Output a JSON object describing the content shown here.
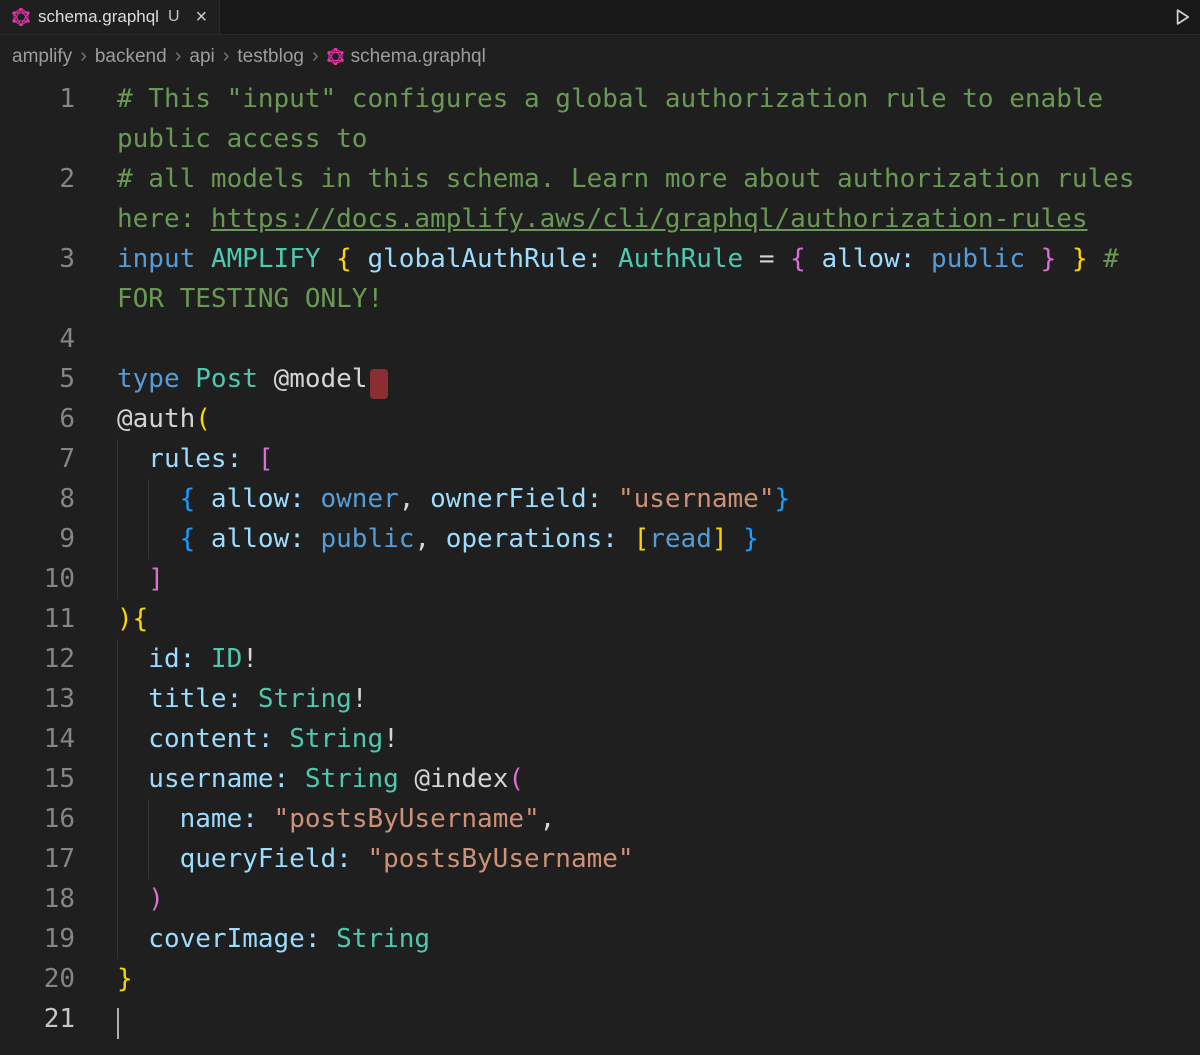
{
  "tab": {
    "label": "schema.graphql",
    "git_status": "U",
    "close_glyph": "×"
  },
  "breadcrumbs": {
    "items": [
      "amplify",
      "backend",
      "api",
      "testblog"
    ],
    "file": "schema.graphql",
    "separator": "›"
  },
  "colors": {
    "background": "#1f1f1f",
    "tabbar_background": "#181818",
    "accent_graphql": "#e535ab",
    "gutter": "#858585",
    "gutter_active": "#c6c6c6",
    "red_block": "#8b2e31",
    "cursor": "#aeafad",
    "tokens": {
      "plain": "#d4d4d4",
      "comment": "#6a9955",
      "keyword": "#569cd6",
      "type": "#4ec9b0",
      "property": "#9cdcfe",
      "value": "#569cd6",
      "string": "#ce9178",
      "bracket1": "#ffd700",
      "bracket2": "#da70d6",
      "bracket3": "#179fff"
    }
  },
  "editor": {
    "lines": [
      {
        "num": "1",
        "indent": 0,
        "segments": [
          {
            "t": "# This \"input\" configures a global authorization rule to enable public access to",
            "c": "comment"
          }
        ]
      },
      {
        "num": "2",
        "indent": 0,
        "segments": [
          {
            "t": "# all models in this schema. Learn more about authorization rules here: ",
            "c": "comment"
          },
          {
            "t": "https://docs.amplify.aws/cli/graphql/authorization-rules",
            "c": "comment",
            "u": true
          }
        ]
      },
      {
        "num": "3",
        "indent": 0,
        "segments": [
          {
            "t": "input",
            "c": "keyword"
          },
          {
            "t": " ",
            "c": "plain"
          },
          {
            "t": "AMPLIFY",
            "c": "type"
          },
          {
            "t": " ",
            "c": "plain"
          },
          {
            "t": "{",
            "c": "bracket1"
          },
          {
            "t": " ",
            "c": "plain"
          },
          {
            "t": "globalAuthRule:",
            "c": "property"
          },
          {
            "t": " ",
            "c": "plain"
          },
          {
            "t": "AuthRule",
            "c": "type"
          },
          {
            "t": " ",
            "c": "plain"
          },
          {
            "t": "=",
            "c": "plain"
          },
          {
            "t": " ",
            "c": "plain"
          },
          {
            "t": "{",
            "c": "bracket2"
          },
          {
            "t": " ",
            "c": "plain"
          },
          {
            "t": "allow:",
            "c": "property"
          },
          {
            "t": " ",
            "c": "plain"
          },
          {
            "t": "public",
            "c": "value"
          },
          {
            "t": " ",
            "c": "plain"
          },
          {
            "t": "}",
            "c": "bracket2"
          },
          {
            "t": " ",
            "c": "plain"
          },
          {
            "t": "}",
            "c": "bracket1"
          },
          {
            "t": " ",
            "c": "plain"
          },
          {
            "t": "# FOR TESTING ONLY!",
            "c": "comment"
          }
        ]
      },
      {
        "num": "4",
        "indent": 0,
        "segments": []
      },
      {
        "num": "5",
        "indent": 0,
        "segments": [
          {
            "t": "type",
            "c": "keyword"
          },
          {
            "t": " ",
            "c": "plain"
          },
          {
            "t": "Post",
            "c": "type"
          },
          {
            "t": " ",
            "c": "plain"
          },
          {
            "t": "@model",
            "c": "plain"
          },
          {
            "marker": "red-block"
          }
        ]
      },
      {
        "num": "6",
        "indent": 0,
        "segments": [
          {
            "t": "@auth",
            "c": "plain"
          },
          {
            "t": "(",
            "c": "bracket1"
          }
        ]
      },
      {
        "num": "7",
        "indent": 2,
        "segments": [
          {
            "t": "rules:",
            "c": "property"
          },
          {
            "t": " ",
            "c": "plain"
          },
          {
            "t": "[",
            "c": "bracket2"
          }
        ]
      },
      {
        "num": "8",
        "indent": 4,
        "segments": [
          {
            "t": "{",
            "c": "bracket3"
          },
          {
            "t": " ",
            "c": "plain"
          },
          {
            "t": "allow:",
            "c": "property"
          },
          {
            "t": " ",
            "c": "plain"
          },
          {
            "t": "owner",
            "c": "value"
          },
          {
            "t": ",",
            "c": "plain"
          },
          {
            "t": " ",
            "c": "plain"
          },
          {
            "t": "ownerField:",
            "c": "property"
          },
          {
            "t": " ",
            "c": "plain"
          },
          {
            "t": "\"username\"",
            "c": "string"
          },
          {
            "t": "}",
            "c": "bracket3"
          }
        ]
      },
      {
        "num": "9",
        "indent": 4,
        "segments": [
          {
            "t": "{",
            "c": "bracket3"
          },
          {
            "t": " ",
            "c": "plain"
          },
          {
            "t": "allow:",
            "c": "property"
          },
          {
            "t": " ",
            "c": "plain"
          },
          {
            "t": "public",
            "c": "value"
          },
          {
            "t": ",",
            "c": "plain"
          },
          {
            "t": " ",
            "c": "plain"
          },
          {
            "t": "operations:",
            "c": "property"
          },
          {
            "t": " ",
            "c": "plain"
          },
          {
            "t": "[",
            "c": "bracket1"
          },
          {
            "t": "read",
            "c": "value"
          },
          {
            "t": "]",
            "c": "bracket1"
          },
          {
            "t": " ",
            "c": "plain"
          },
          {
            "t": "}",
            "c": "bracket3"
          }
        ]
      },
      {
        "num": "10",
        "indent": 2,
        "segments": [
          {
            "t": "]",
            "c": "bracket2"
          }
        ]
      },
      {
        "num": "11",
        "indent": 0,
        "segments": [
          {
            "t": ")",
            "c": "bracket1"
          },
          {
            "t": "{",
            "c": "bracket1"
          }
        ]
      },
      {
        "num": "12",
        "indent": 2,
        "segments": [
          {
            "t": "id:",
            "c": "property"
          },
          {
            "t": " ",
            "c": "plain"
          },
          {
            "t": "ID",
            "c": "type"
          },
          {
            "t": "!",
            "c": "plain"
          }
        ]
      },
      {
        "num": "13",
        "indent": 2,
        "segments": [
          {
            "t": "title:",
            "c": "property"
          },
          {
            "t": " ",
            "c": "plain"
          },
          {
            "t": "String",
            "c": "type"
          },
          {
            "t": "!",
            "c": "plain"
          }
        ]
      },
      {
        "num": "14",
        "indent": 2,
        "segments": [
          {
            "t": "content:",
            "c": "property"
          },
          {
            "t": " ",
            "c": "plain"
          },
          {
            "t": "String",
            "c": "type"
          },
          {
            "t": "!",
            "c": "plain"
          }
        ]
      },
      {
        "num": "15",
        "indent": 2,
        "segments": [
          {
            "t": "username:",
            "c": "property"
          },
          {
            "t": " ",
            "c": "plain"
          },
          {
            "t": "String",
            "c": "type"
          },
          {
            "t": " ",
            "c": "plain"
          },
          {
            "t": "@index",
            "c": "plain"
          },
          {
            "t": "(",
            "c": "bracket2"
          }
        ]
      },
      {
        "num": "16",
        "indent": 4,
        "segments": [
          {
            "t": "name:",
            "c": "property"
          },
          {
            "t": " ",
            "c": "plain"
          },
          {
            "t": "\"postsByUsername\"",
            "c": "string"
          },
          {
            "t": ",",
            "c": "plain"
          }
        ]
      },
      {
        "num": "17",
        "indent": 4,
        "segments": [
          {
            "t": "queryField:",
            "c": "property"
          },
          {
            "t": " ",
            "c": "plain"
          },
          {
            "t": "\"postsByUsername\"",
            "c": "string"
          }
        ]
      },
      {
        "num": "18",
        "indent": 2,
        "segments": [
          {
            "t": ")",
            "c": "bracket2"
          }
        ]
      },
      {
        "num": "19",
        "indent": 2,
        "segments": [
          {
            "t": "coverImage:",
            "c": "property"
          },
          {
            "t": " ",
            "c": "plain"
          },
          {
            "t": "String",
            "c": "type"
          }
        ]
      },
      {
        "num": "20",
        "indent": 0,
        "segments": [
          {
            "t": "}",
            "c": "bracket1"
          }
        ]
      },
      {
        "num": "21",
        "indent": 0,
        "active": true,
        "segments": [
          {
            "marker": "cursor"
          }
        ]
      }
    ]
  }
}
